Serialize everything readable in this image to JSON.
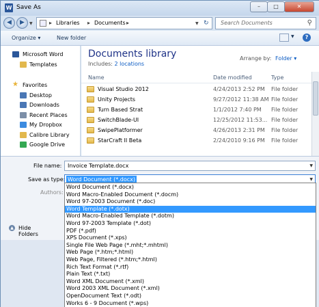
{
  "window": {
    "title": "Save As",
    "app_icon_letter": "W",
    "min_label": "–",
    "max_label": "□",
    "close_label": "✕"
  },
  "nav": {
    "breadcrumb": [
      "Libraries",
      "Documents"
    ],
    "search_placeholder": "Search Documents"
  },
  "toolbar": {
    "organize": "Organize ▾",
    "new_folder": "New folder"
  },
  "sidebar": {
    "items": [
      {
        "label": "Microsoft Word",
        "icon": "word-icon",
        "color": "#2b579a",
        "indent": false
      },
      {
        "label": "Templates",
        "icon": "folder-icon",
        "color": "#e2b84d",
        "indent": true
      },
      {
        "label": "Favorites",
        "icon": "star-icon",
        "color": "#e8b339",
        "indent": false
      },
      {
        "label": "Desktop",
        "icon": "desktop-icon",
        "color": "#4a77b5",
        "indent": true
      },
      {
        "label": "Downloads",
        "icon": "downloads-icon",
        "color": "#4a77b5",
        "indent": true
      },
      {
        "label": "Recent Places",
        "icon": "recent-places-icon",
        "color": "#7d8fa8",
        "indent": true
      },
      {
        "label": "My Dropbox",
        "icon": "dropbox-icon",
        "color": "#3c8be0",
        "indent": true
      },
      {
        "label": "Calibre Library",
        "icon": "folder-icon",
        "color": "#e2b84d",
        "indent": true
      },
      {
        "label": "Google Drive",
        "icon": "google-drive-icon",
        "color": "#34a853",
        "indent": true
      }
    ]
  },
  "library": {
    "title": "Documents library",
    "includes_label": "Includes:",
    "includes_link": "2 locations",
    "arrange_label": "Arrange by:",
    "arrange_value": "Folder ▾",
    "columns": [
      "Name",
      "Date modified",
      "Type"
    ],
    "rows": [
      {
        "name": "Visual Studio 2012",
        "date": "4/24/2013 2:52 PM",
        "type": "File folder"
      },
      {
        "name": "Unity Projects",
        "date": "9/27/2012 11:38 AM",
        "type": "File folder"
      },
      {
        "name": "Turn Based Strat",
        "date": "1/1/2012 7:40 PM",
        "type": "File folder"
      },
      {
        "name": "SwitchBlade-UI",
        "date": "12/25/2012 11:53...",
        "type": "File folder"
      },
      {
        "name": "SwipePlatformer",
        "date": "4/26/2013 2:31 PM",
        "type": "File folder"
      },
      {
        "name": "StarCraft II Beta",
        "date": "2/24/2010 9:16 PM",
        "type": "File folder"
      }
    ]
  },
  "form": {
    "filename_label": "File name:",
    "filename_value": "Invoice Template.docx",
    "savetype_label": "Save as type:",
    "savetype_value": "Word Document (*.docx)",
    "authors_label": "Authors:",
    "hide_folders": "Hide Folders"
  },
  "save_type_options": [
    "Word Document (*.docx)",
    "Word Macro-Enabled Document (*.docm)",
    "Word 97-2003 Document (*.doc)",
    "Word Template (*.dotx)",
    "Word Macro-Enabled Template (*.dotm)",
    "Word 97-2003 Template (*.dot)",
    "PDF (*.pdf)",
    "XPS Document (*.xps)",
    "Single File Web Page (*.mht;*.mhtml)",
    "Web Page (*.htm;*.html)",
    "Web Page, Filtered (*.htm;*.html)",
    "Rich Text Format (*.rtf)",
    "Plain Text (*.txt)",
    "Word XML Document (*.xml)",
    "Word 2003 XML Document (*.xml)",
    "OpenDocument Text (*.odt)",
    "Works 6 - 9 Document (*.wps)"
  ],
  "selected_option_index": 3
}
